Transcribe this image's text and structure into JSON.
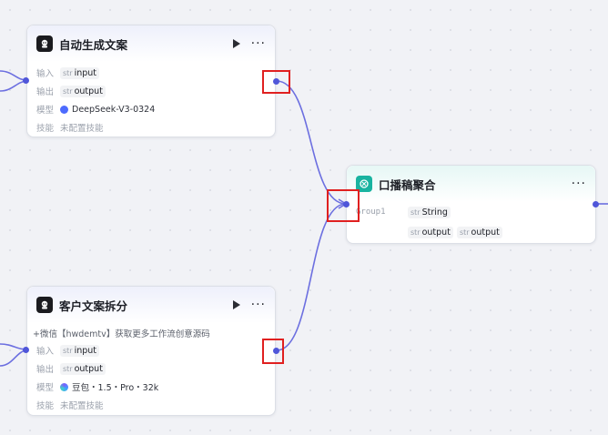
{
  "nodes": {
    "gen": {
      "title": "自动生成文案",
      "input_label": "输入",
      "input_type": "str",
      "input_value": "input",
      "output_label": "输出",
      "output_type": "str",
      "output_value": "output",
      "model_label": "模型",
      "model_value": "DeepSeek-V3-0324",
      "skill_label": "技能",
      "skill_value": "未配置技能"
    },
    "agg": {
      "title": "口播稿聚合",
      "group_label": "Group1",
      "row1_type": "str",
      "row1_value": "String",
      "row2a_type": "str",
      "row2a_value": "output",
      "row2b_type": "str",
      "row2b_value": "output"
    },
    "split": {
      "title": "客户文案拆分",
      "description": "+微信【hwdemtv】获取更多工作流创意源码",
      "input_label": "输入",
      "input_type": "str",
      "input_value": "input",
      "output_label": "输出",
      "output_type": "str",
      "output_value": "output",
      "model_label": "模型",
      "model_value": "豆包・1.5・Pro・32k",
      "skill_label": "技能",
      "skill_value": "未配置技能"
    }
  },
  "icons": {
    "llm_node": "robot-icon",
    "aggregate_node": "merge-icon",
    "run": "play-icon",
    "more": "more-icon",
    "deepseek_model": "deepseek-icon",
    "doubao_model": "doubao-icon"
  },
  "colors": {
    "wire": "#6c6fe0",
    "port": "#4f56d9",
    "highlight": "#e02020",
    "aggregate_accent": "#19b3a0"
  }
}
